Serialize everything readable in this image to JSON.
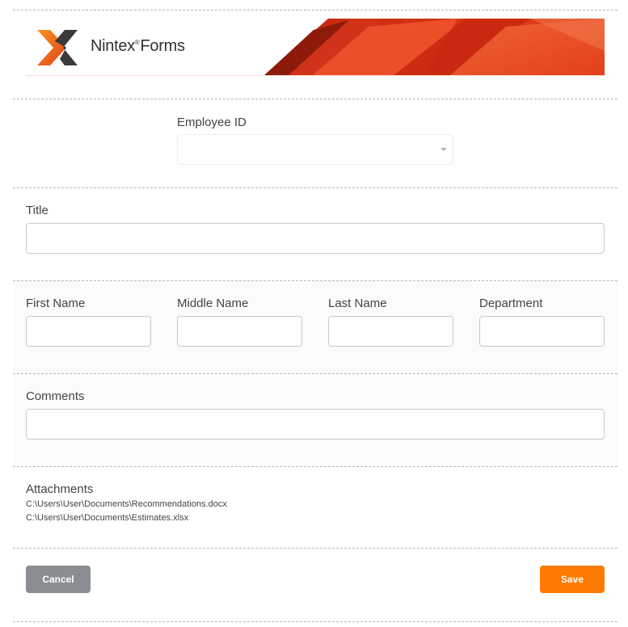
{
  "header": {
    "brand": "Nintex",
    "brand_mark": "®",
    "product": "Forms"
  },
  "form": {
    "employee_id": {
      "label": "Employee ID",
      "value": ""
    },
    "title": {
      "label": "Title",
      "value": ""
    },
    "first_name": {
      "label": "First Name",
      "value": ""
    },
    "middle_name": {
      "label": "Middle Name",
      "value": ""
    },
    "last_name": {
      "label": "Last Name",
      "value": ""
    },
    "department": {
      "label": "Department",
      "value": ""
    },
    "comments": {
      "label": "Comments",
      "value": ""
    },
    "attachments": {
      "label": "Attachments",
      "files": [
        "C:\\Users\\User\\Documents\\Recommendations.docx",
        "C:\\Users\\User\\Documents\\Estimates.xlsx"
      ]
    }
  },
  "actions": {
    "cancel_label": "Cancel",
    "save_label": "Save"
  },
  "colors": {
    "save_button": "#ff7a00",
    "cancel_button": "#8a8d91",
    "banner_accent": "#e2401a"
  },
  "icons": {
    "logo": "nintex-x-logo-icon",
    "dropdown": "chevron-down-icon"
  }
}
